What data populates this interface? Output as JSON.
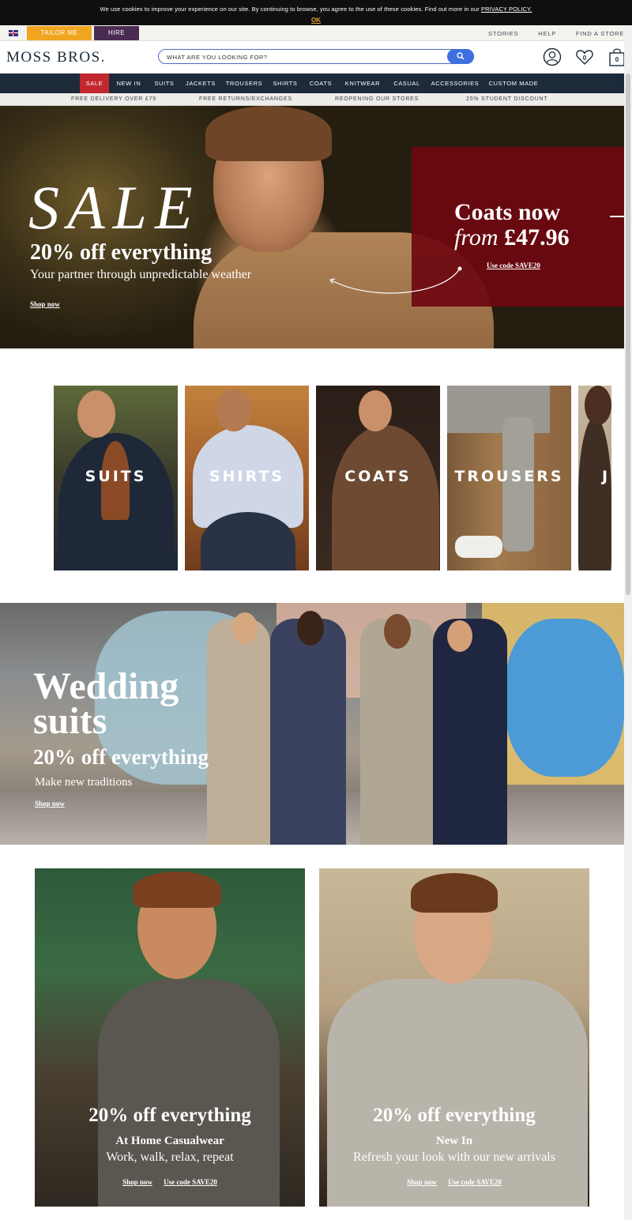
{
  "cookie": {
    "message": "We use cookies to improve your experience on our site. By continuing to browse, you agree to the use of these cookies. Find out more in our",
    "policy_link": "PRIVACY POLICY.",
    "ok": "OK"
  },
  "utility": {
    "tailor_me": "TAILOR ME",
    "hire": "HIRE",
    "links": [
      "STORIES",
      "HELP",
      "FIND A STORE"
    ]
  },
  "header": {
    "logo": "MOSS BROS.",
    "search_placeholder": "WHAT ARE YOU LOOKING FOR?",
    "wishlist_count": "0",
    "basket_count": "0"
  },
  "nav": {
    "items": [
      "SALE",
      "NEW IN",
      "SUITS",
      "JACKETS",
      "TROUSERS",
      "SHIRTS",
      "COATS",
      "KNITWEAR",
      "CASUAL",
      "ACCESSORIES",
      "CUSTOM MADE"
    ]
  },
  "promo": {
    "items": [
      "FREE DELIVERY OVER £75",
      "FREE RETURNS/EXCHANGES",
      "REOPENING OUR STORES",
      "25% STUDENT DISCOUNT"
    ]
  },
  "hero": {
    "headline": "SALE",
    "offer": "20% off everything",
    "subtitle": "Your partner through unpredictable weather",
    "cta": "Shop now",
    "box_line1": "Coats now",
    "box_from": "from",
    "box_price": "£47.96",
    "box_code": "Use code SAVE20"
  },
  "categories": {
    "items": [
      "SUITS",
      "SHIRTS",
      "COATS",
      "TROUSERS",
      "J"
    ]
  },
  "wedding": {
    "line1": "Wedding",
    "line2": "suits",
    "offer": "20% off everything",
    "subtitle": "Make new traditions",
    "cta": "Shop now"
  },
  "cards": [
    {
      "offer": "20% off everything",
      "title": "At Home Casualwear",
      "subtitle": "Work, walk, relax, repeat",
      "cta": "Shop now",
      "code": "Use code SAVE20"
    },
    {
      "offer": "20% off everything",
      "title": "New In",
      "subtitle": "Refresh your look with our new arrivals",
      "cta": "Shop now",
      "code": "Use code SAVE20"
    }
  ]
}
